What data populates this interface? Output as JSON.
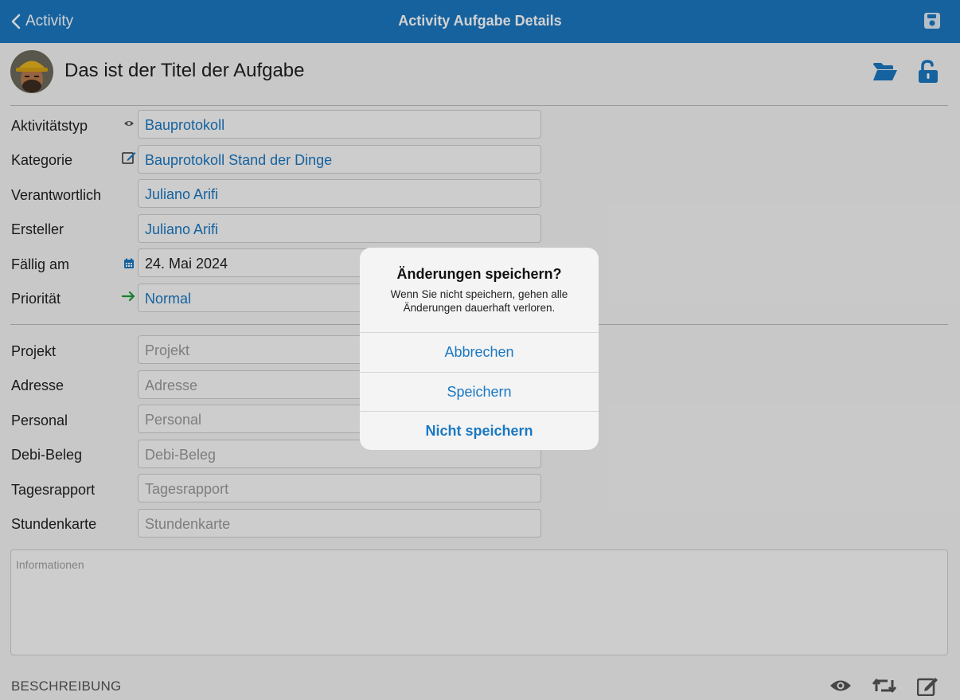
{
  "nav": {
    "back_label": "Activity",
    "title": "Activity Aufgabe Details"
  },
  "task": {
    "title": "Das ist der Titel der Aufgabe"
  },
  "details": [
    {
      "label": "Aktivitätstyp",
      "value": "Bauprotokoll",
      "icon": "eye-icon"
    },
    {
      "label": "Kategorie",
      "value": "Bauprotokoll Stand der Dinge",
      "icon": "edit-icon"
    },
    {
      "label": "Verantwortlich",
      "value": "Juliano Arifi"
    },
    {
      "label": "Ersteller",
      "value": "Juliano Arifi"
    },
    {
      "label": "Fällig am",
      "value": "24. Mai 2024",
      "icon": "calendar-icon"
    },
    {
      "label": "Priorität",
      "value": "Normal",
      "icon": "arrow-right-icon"
    }
  ],
  "links": [
    {
      "label": "Projekt",
      "placeholder": "Projekt"
    },
    {
      "label": "Adresse",
      "placeholder": "Adresse"
    },
    {
      "label": "Personal",
      "placeholder": "Personal"
    },
    {
      "label": "Debi-Beleg",
      "placeholder": "Debi-Beleg"
    },
    {
      "label": "Tagesrapport",
      "placeholder": "Tagesrapport"
    },
    {
      "label": "Stundenkarte",
      "placeholder": "Stundenkarte"
    }
  ],
  "info": {
    "placeholder": "Informationen"
  },
  "description": {
    "title": "BESCHREIBUNG"
  },
  "dialog": {
    "title": "Änderungen speichern?",
    "message": "Wenn Sie nicht speichern, gehen alle Änderungen dauerhaft verloren.",
    "cancel_label": "Abbrechen",
    "save_label": "Speichern",
    "discard_label": "Nicht speichern"
  },
  "colors": {
    "accent": "#1a78c2",
    "priority_green": "#1e9e3a"
  }
}
